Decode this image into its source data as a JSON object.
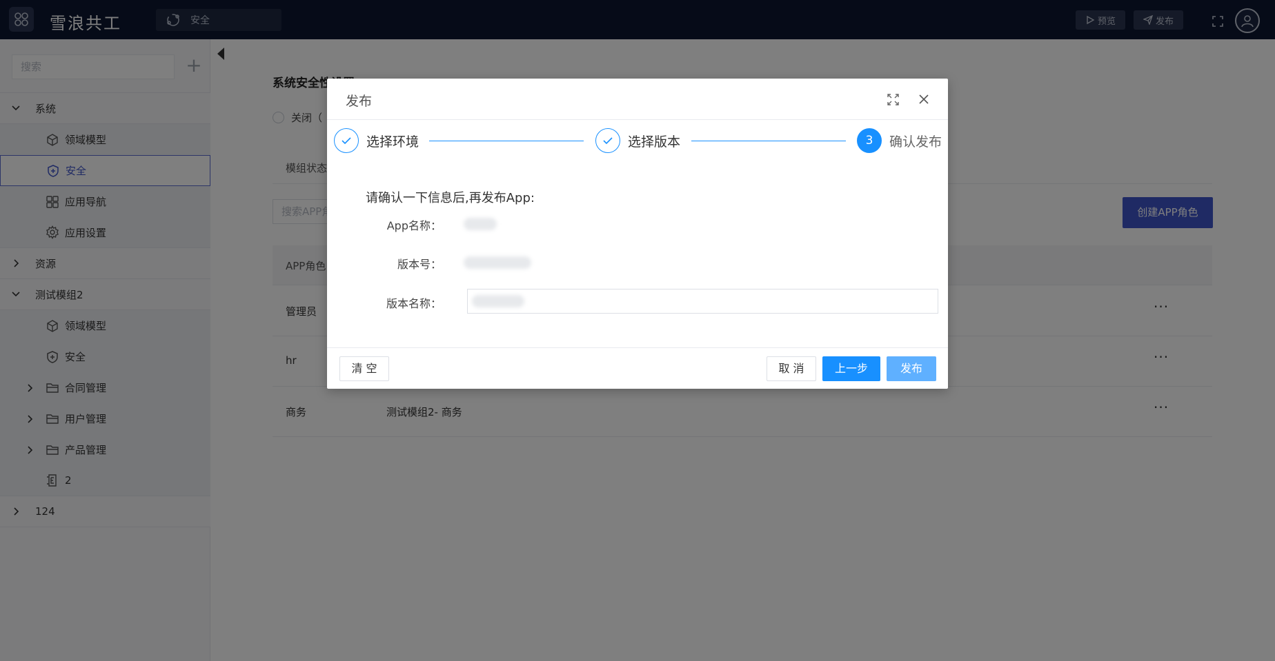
{
  "topbar": {
    "brand": "雪浪共工",
    "module_tab": "安全",
    "preview_label": "预览",
    "publish_label": "发布"
  },
  "sidebar": {
    "search_placeholder": "搜索",
    "groups": [
      {
        "label": "系统",
        "expanded": true,
        "children": [
          {
            "label": "领域模型",
            "icon": "cube-icon"
          },
          {
            "label": "安全",
            "icon": "shield-icon",
            "active": true
          },
          {
            "label": "应用导航",
            "icon": "grid-icon"
          },
          {
            "label": "应用设置",
            "icon": "gear-icon"
          }
        ]
      },
      {
        "label": "资源",
        "expanded": false
      },
      {
        "label": "测试模组2",
        "expanded": true,
        "children": [
          {
            "label": "领域模型",
            "icon": "cube-icon"
          },
          {
            "label": "安全",
            "icon": "shield-icon"
          },
          {
            "label": "合同管理",
            "icon": "folder-icon"
          },
          {
            "label": "用户管理",
            "icon": "folder-icon"
          },
          {
            "label": "产品管理",
            "icon": "folder-icon"
          },
          {
            "label": "2",
            "icon": "entity-icon"
          }
        ]
      },
      {
        "label": "124",
        "expanded": false
      }
    ]
  },
  "main": {
    "title": "系统安全性设置",
    "radio_close": "关闭（",
    "status_label": "模组状态",
    "search_placeholder": "搜索APP角",
    "create_button": "创建APP角色",
    "table_header_role": "APP角色",
    "rows": [
      {
        "role": "管理员",
        "desc": ""
      },
      {
        "role": "hr",
        "desc": ""
      },
      {
        "role": "商务",
        "desc": "测试模组2- 商务"
      }
    ],
    "more": "···"
  },
  "modal": {
    "title": "发布",
    "steps": [
      {
        "label": "选择环境",
        "status": "done"
      },
      {
        "label": "选择版本",
        "status": "done"
      },
      {
        "label": "确认发布",
        "status": "current",
        "number": "3"
      }
    ],
    "confirm_text": "请确认一下信息后,再发布App:",
    "fields": {
      "app_name_label": "App名称：",
      "version_label": "版本号：",
      "version_name_label": "版本名称："
    },
    "buttons": {
      "clear": "清 空",
      "cancel": "取 消",
      "prev": "上一步",
      "publish": "发布"
    }
  },
  "colors": {
    "topbar": "#0c1730",
    "accent": "#1890ff",
    "primary_dark": "#3e54c9"
  }
}
